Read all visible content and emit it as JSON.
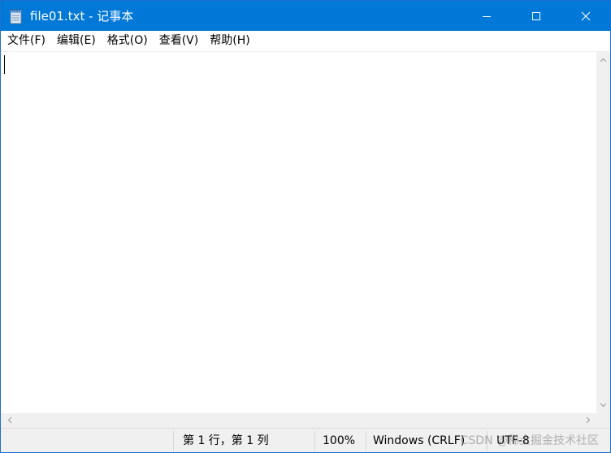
{
  "window": {
    "title": "file01.txt - 记事本",
    "accent_color": "#0078d7"
  },
  "caption": {
    "minimize_icon": "minimize-icon",
    "maximize_icon": "maximize-icon",
    "close_icon": "close-icon"
  },
  "menu": {
    "items": [
      {
        "label": "文件(F)"
      },
      {
        "label": "编辑(E)"
      },
      {
        "label": "格式(O)"
      },
      {
        "label": "查看(V)"
      },
      {
        "label": "帮助(H)"
      }
    ]
  },
  "editor": {
    "content": ""
  },
  "status": {
    "position": "第 1 行，第 1 列",
    "zoom": "100%",
    "line_ending": "Windows (CRLF)",
    "encoding": "UTF-8"
  },
  "watermark": {
    "text": "CSDN @稀土掘金技术社区"
  }
}
